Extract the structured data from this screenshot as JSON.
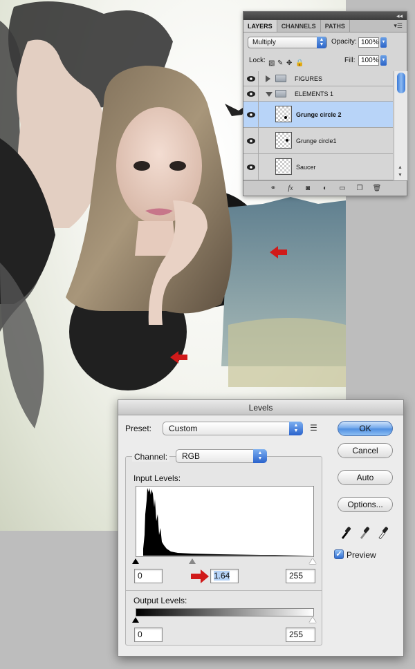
{
  "layers_panel": {
    "tabs": [
      "LAYERS",
      "CHANNELS",
      "PATHS"
    ],
    "blend_mode": "Multiply",
    "opacity_label": "Opacity:",
    "opacity_value": "100%",
    "lock_label": "Lock:",
    "fill_label": "Fill:",
    "fill_value": "100%",
    "layers": [
      {
        "name": "FIGURES",
        "type": "group",
        "expanded": false
      },
      {
        "name": "ELEMENTS 1",
        "type": "group",
        "expanded": true
      },
      {
        "name": "Grunge circle 2",
        "type": "layer",
        "selected": true
      },
      {
        "name": "Grunge circle1",
        "type": "layer",
        "selected": false
      },
      {
        "name": "Saucer",
        "type": "layer",
        "selected": false
      }
    ],
    "footer_icons": [
      "link-icon",
      "fx-icon",
      "mask-icon",
      "adjustment-icon",
      "folder-icon",
      "new-layer-icon",
      "trash-icon"
    ]
  },
  "levels_dialog": {
    "title": "Levels",
    "preset_label": "Preset:",
    "preset_value": "Custom",
    "channel_label": "Channel:",
    "channel_value": "RGB",
    "input_levels_label": "Input Levels:",
    "input_black": "0",
    "input_gamma": "1.64",
    "input_white": "255",
    "output_levels_label": "Output Levels:",
    "output_black": "0",
    "output_white": "255",
    "ok_label": "OK",
    "cancel_label": "Cancel",
    "auto_label": "Auto",
    "options_label": "Options...",
    "preview_label": "Preview",
    "preview_checked": true
  },
  "colors": {
    "selection": "#b8d4f8",
    "accent_blue": "#2c64c8",
    "annotation_red": "#d01a1a"
  }
}
